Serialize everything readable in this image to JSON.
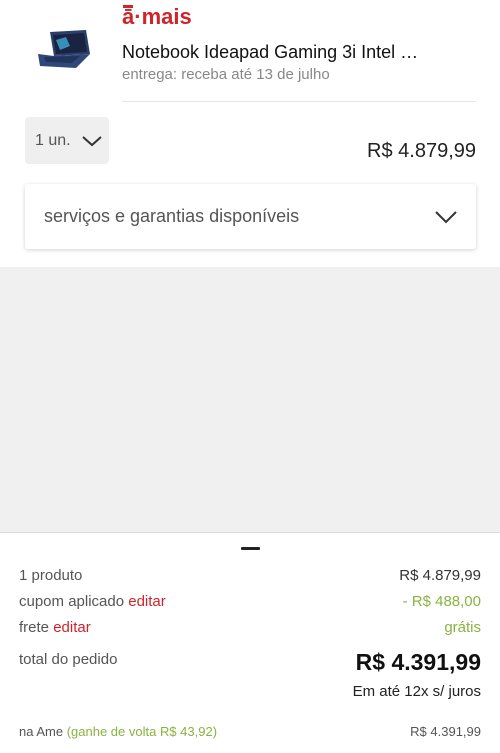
{
  "product": {
    "brand_accent": "ā",
    "brand_rest": "·mais",
    "title": "Notebook Ideapad Gaming 3i Intel …",
    "delivery": "entrega: receba até 13 de julho",
    "quantity": "1 un.",
    "price": "R$ 4.879,99",
    "services_label": "serviços e garantias disponíveis"
  },
  "summary": {
    "products_label": "1 produto",
    "products_value": "R$ 4.879,99",
    "coupon_label": "cupom aplicado",
    "coupon_edit": "editar",
    "coupon_value": "- R$ 488,00",
    "shipping_label": "frete",
    "shipping_edit": "editar",
    "shipping_value": "grátis",
    "total_label": "total do pedido",
    "total_value": "R$ 4.391,99",
    "installments": "Em até 12x s/ juros",
    "ame_label": "na Ame",
    "ame_cashback": "(ganhe de volta R$ 43,92)",
    "ame_value": "R$ 4.391,99"
  },
  "icons": {
    "product_thumbnail": "laptop-icon",
    "quantity_chevron": "chevron-down-icon",
    "services_chevron": "chevron-down-icon"
  },
  "colors": {
    "brand_red": "#d0232b",
    "discount_green": "#8ab341",
    "panel_gray": "#f0f0f0"
  }
}
